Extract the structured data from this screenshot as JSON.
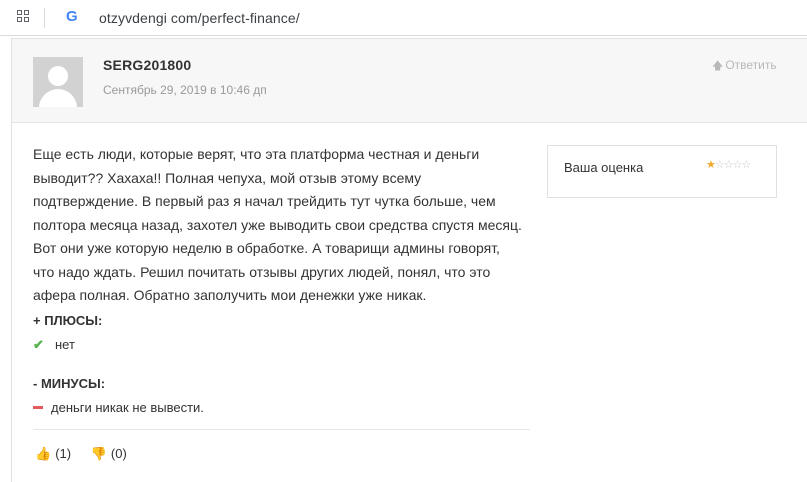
{
  "browser": {
    "url": "otzyvdengi com/perfect-finance/",
    "favicon": "google-g-icon"
  },
  "review": {
    "author": "SERG201800",
    "date": "Сентябрь 29, 2019 в 10:46 дп",
    "reply_label": "Ответить",
    "text": "Еще есть люди, которые верят, что эта платформа честная и деньги выводит?? Хахаха!! Полная чепуха, мой отзыв этому всему подтверждение. В первый раз я начал трейдить тут чутка больше, чем полтора месяца назад, захотел уже выводить свои средства спустя месяц. Вот они уже которую неделю в обработке. А товарищи админы говорят, что надо ждать. Решил почитать отзывы других людей, понял, что это афера полная. Обратно заполучить мои денежки уже никак.",
    "pros_title": "+ ПЛЮСЫ:",
    "pros": [
      "нет"
    ],
    "cons_title": "- МИНУСЫ:",
    "cons": [
      "деньги никак не вывести."
    ],
    "likes": "(1)",
    "dislikes": "(0)"
  },
  "rating": {
    "label": "Ваша оценка",
    "value": 1,
    "max": 5
  },
  "colors": {
    "accent_green": "#58b34e",
    "accent_red": "#e35b5b",
    "star": "#f0a92c"
  }
}
